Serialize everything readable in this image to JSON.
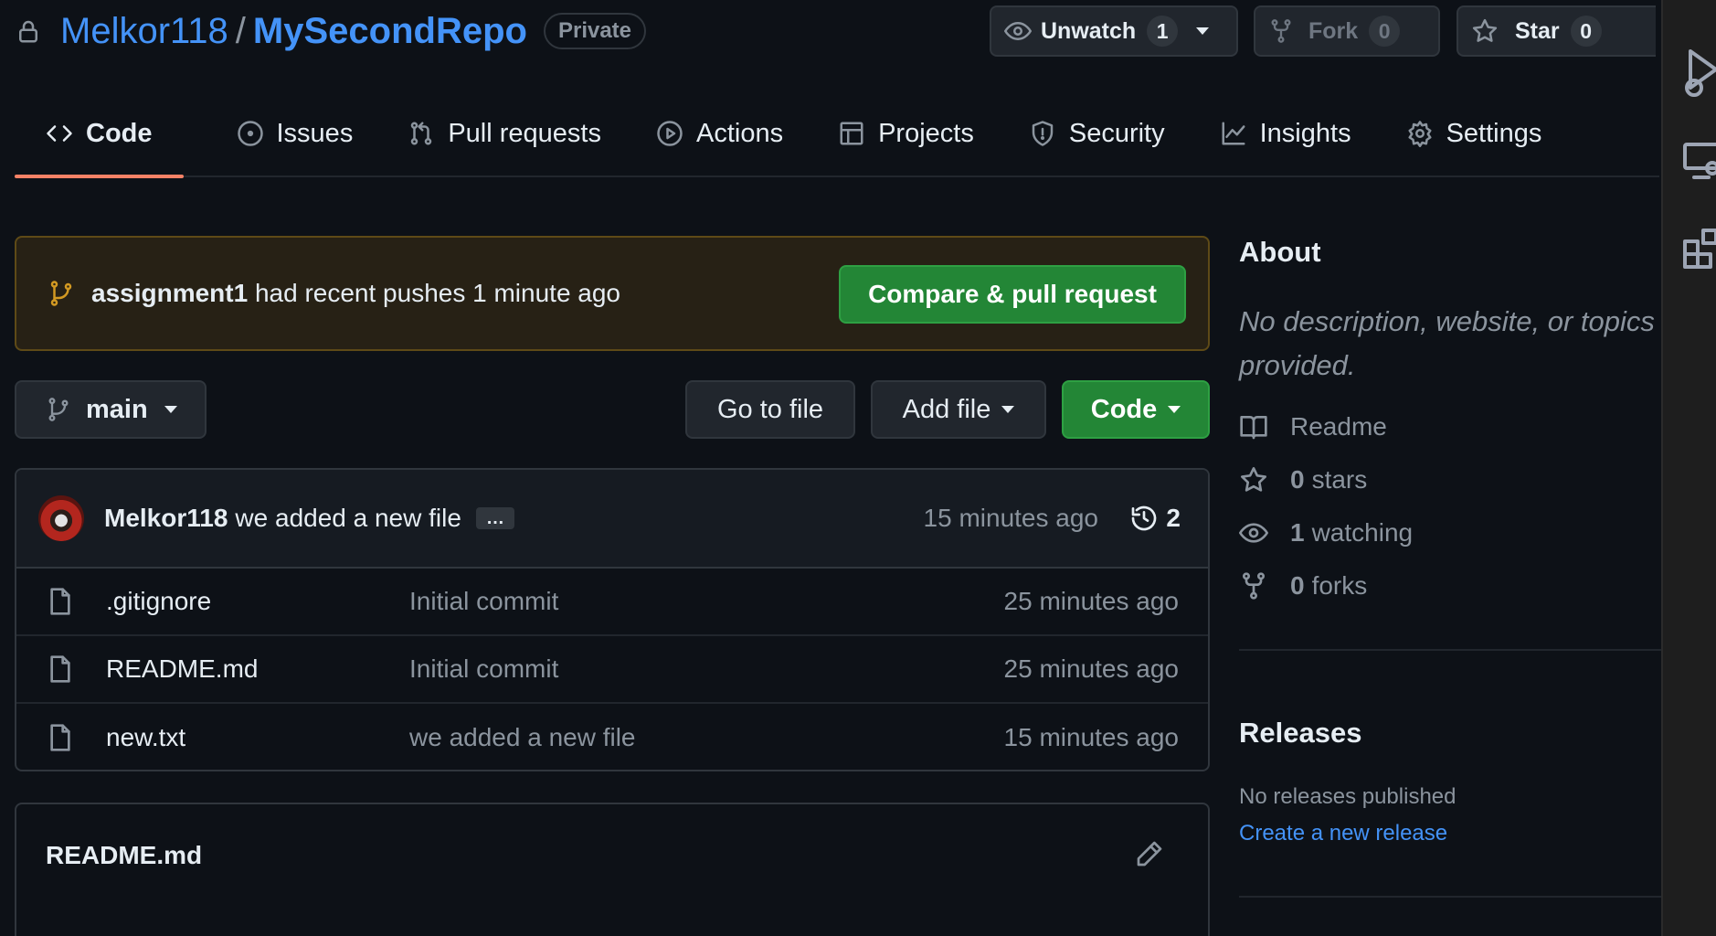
{
  "repo": {
    "owner": "Melkor118",
    "separator": "/",
    "name": "MySecondRepo",
    "visibility": "Private"
  },
  "actions": {
    "watch": {
      "label": "Unwatch",
      "count": "1"
    },
    "fork": {
      "label": "Fork",
      "count": "0"
    },
    "star": {
      "label": "Star",
      "count": "0"
    }
  },
  "tabs": [
    {
      "label": "Code",
      "icon": "code-icon"
    },
    {
      "label": "Issues",
      "icon": "issue-icon"
    },
    {
      "label": "Pull requests",
      "icon": "pull-request-icon"
    },
    {
      "label": "Actions",
      "icon": "play-icon"
    },
    {
      "label": "Projects",
      "icon": "table-icon"
    },
    {
      "label": "Security",
      "icon": "shield-icon"
    },
    {
      "label": "Insights",
      "icon": "graph-icon"
    },
    {
      "label": "Settings",
      "icon": "gear-icon"
    }
  ],
  "banner": {
    "branch": "assignment1",
    "text": "had recent pushes 1 minute ago",
    "button": "Compare & pull request"
  },
  "toolbar": {
    "branch": "main",
    "go_to_file": "Go to file",
    "add_file": "Add file",
    "code": "Code"
  },
  "latest_commit": {
    "author": "Melkor118",
    "message": "we added a new file",
    "ellipsis": "…",
    "time": "15 minutes ago",
    "commit_count": "2"
  },
  "files": [
    {
      "name": ".gitignore",
      "message": "Initial commit",
      "time": "25 minutes ago"
    },
    {
      "name": "README.md",
      "message": "Initial commit",
      "time": "25 minutes ago"
    },
    {
      "name": "new.txt",
      "message": "we added a new file",
      "time": "15 minutes ago"
    }
  ],
  "readme": {
    "title": "README.md"
  },
  "about": {
    "title": "About",
    "description_line1": "No description, website, or topics",
    "description_line2": "provided.",
    "readme": "Readme",
    "stars_count": "0",
    "stars_label": "stars",
    "watching_count": "1",
    "watching_label": "watching",
    "forks_count": "0",
    "forks_label": "forks"
  },
  "releases": {
    "title": "Releases",
    "none_text": "No releases published",
    "create_link": "Create a new release"
  },
  "colors": {
    "accent_link": "#4493f8",
    "green_button": "#238636",
    "tab_underline": "#f78166",
    "banner_bg": "#272115"
  }
}
